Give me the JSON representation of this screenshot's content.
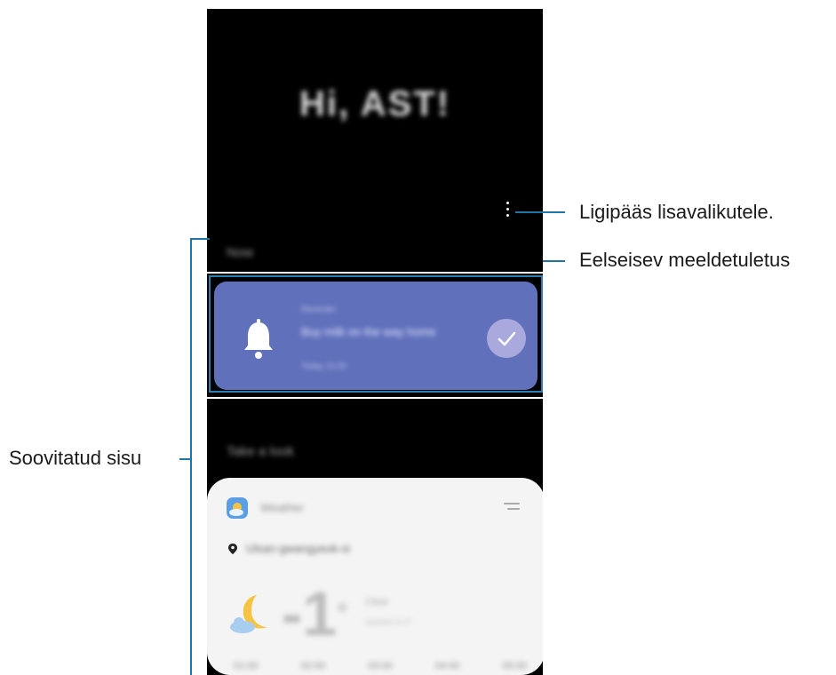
{
  "screen": {
    "greeting": "Hi, AST!",
    "section_now": "Now",
    "reminder": {
      "label": "Reminder",
      "title": "Buy milk on the way home",
      "time": "Today, 21:00"
    },
    "section_look": "Take a look",
    "weather": {
      "app_name": "Weather",
      "location": "Ulsan-gwangyeok-si",
      "temperature": "-1",
      "unit": "°",
      "condition": "Clear",
      "updated": "Updated 21:27",
      "hours": [
        "01:00",
        "02:00",
        "03:00",
        "04:00",
        "05:00"
      ]
    }
  },
  "callouts": {
    "more_options": "Ligipääs lisavalikutele.",
    "upcoming_reminder": "Eelseisev meeldetuletus",
    "suggested_content": "Soovitatud sisu"
  },
  "colors": {
    "reminder_card": "#6070bb",
    "callout_line": "#1d75a8"
  }
}
